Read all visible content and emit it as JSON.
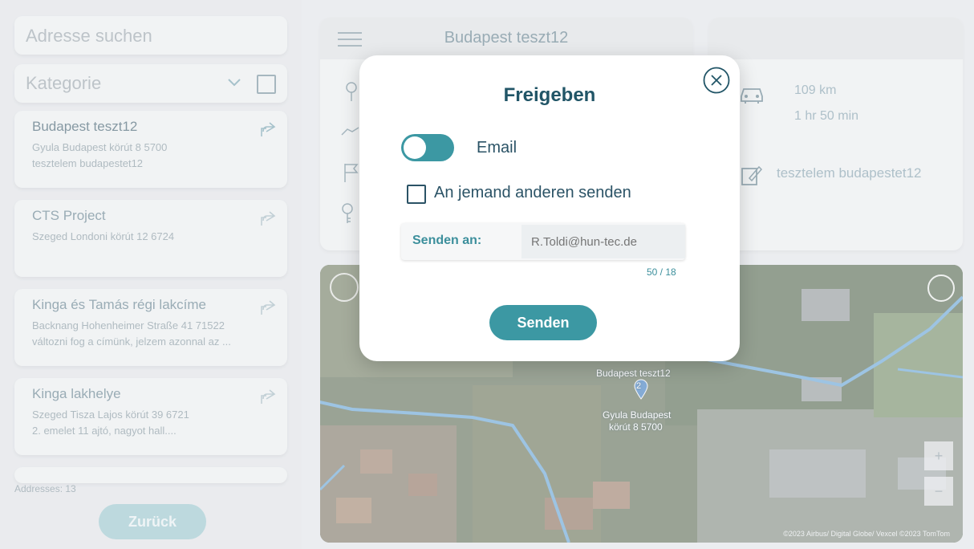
{
  "sidebar": {
    "search_placeholder": "Adresse suchen",
    "category_placeholder": "Kategorie",
    "addresses": [
      {
        "title": "Budapest teszt12",
        "line1": "Gyula Budapest körút 8 5700",
        "line2": "tesztelem budapestet12"
      },
      {
        "title": "CTS Project",
        "line1": "Szeged Londoni körút 12 6724",
        "line2": ""
      },
      {
        "title": "Kinga és Tamás régi lakcíme",
        "line1": "Backnang Hohenheimer Straße 41 71522",
        "line2": "változni fog a címünk, jelzem azonnal az ..."
      },
      {
        "title": "Kinga lakhelye",
        "line1": "Szeged Tisza Lajos körút 39 6721",
        "line2": "2. emelet 11 ajtó, nagyot hall...."
      }
    ],
    "count_label": "Addresses: 13",
    "back_label": "Zurück"
  },
  "header": {
    "title": "Budapest teszt12"
  },
  "info": {
    "distance": "109 km",
    "duration": "1 hr 50 min",
    "note": "tesztelem budapestet12"
  },
  "map": {
    "marker_title": "Budapest teszt12",
    "marker_number": "2",
    "marker_address_1": "Gyula Budapest",
    "marker_address_2": "körút 8 5700",
    "attribution": "©2023 Airbus/ Digital Globe/ Vexcel ©2023 TomTom",
    "zoom_in": "+",
    "zoom_out": "−"
  },
  "dialog": {
    "title": "Freigeben",
    "toggle_label": "Email",
    "toggle_on": true,
    "checkbox_label": "An jemand anderen senden",
    "checkbox_checked": false,
    "send_to_label": "Senden an:",
    "send_to_placeholder": "R.Toldi@hun-tec.de",
    "counter": "50 / 18",
    "send_label": "Senden"
  },
  "colors": {
    "accent": "#3c98a3",
    "text_dark": "#215567"
  }
}
